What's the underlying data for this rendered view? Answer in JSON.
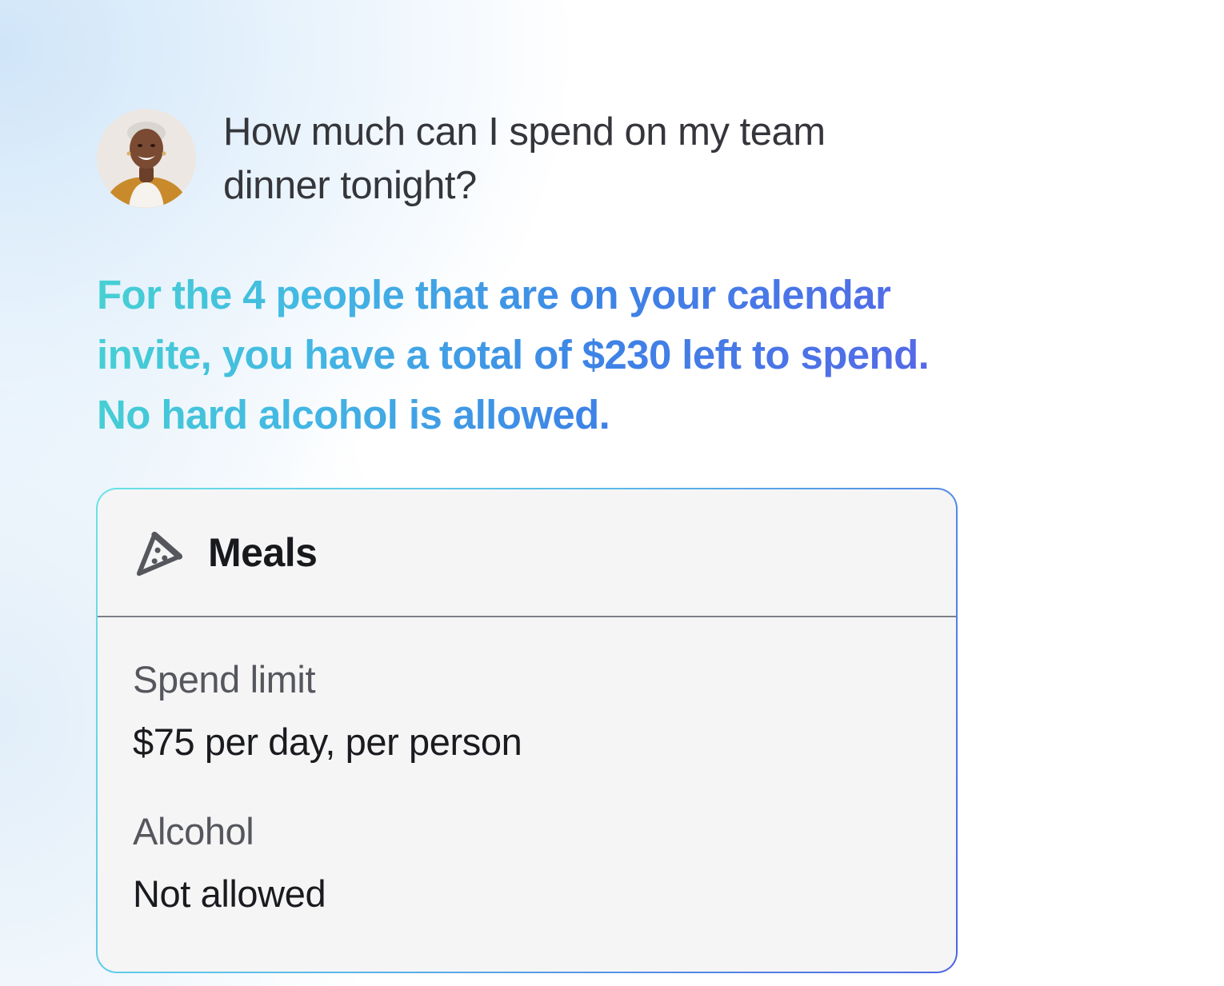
{
  "chat": {
    "user": {
      "avatar_icon": "user-avatar-photo"
    },
    "question": "How much can I spend on my team dinner tonight?",
    "answer": "For the 4 people that are on your calendar invite, you have a total of $230 left to spend. No hard alcohol is allowed.",
    "answer_gradient": [
      "#46d1d2",
      "#43b7e4",
      "#3d84e6",
      "#5a63e8"
    ]
  },
  "policy_card": {
    "icon": "pizza-slice-icon",
    "title": "Meals",
    "border_gradient": [
      "#69e3e6",
      "#5ab9e9",
      "#4e64e2"
    ],
    "fields": [
      {
        "label": "Spend limit",
        "value": "$75 per day, per person"
      },
      {
        "label": "Alcohol",
        "value": "Not allowed"
      }
    ]
  }
}
